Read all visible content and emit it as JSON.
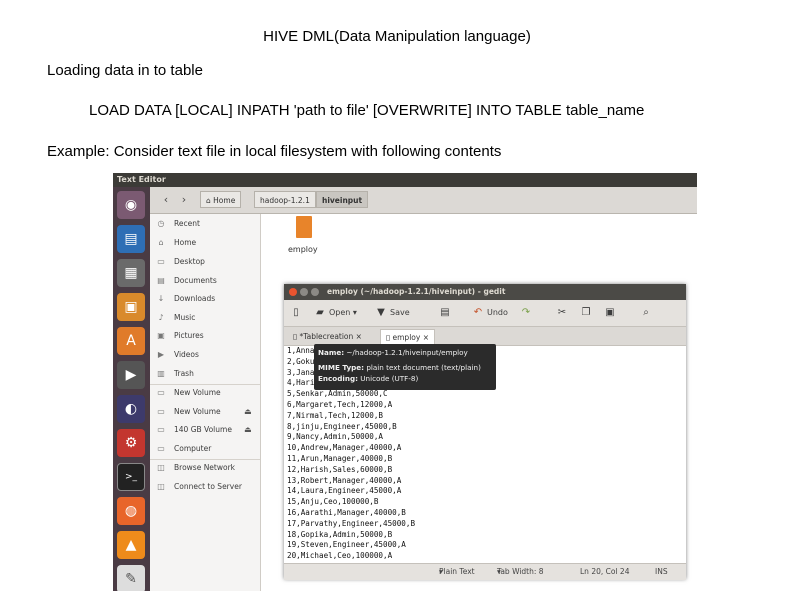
{
  "slide": {
    "title": "HIVE DML(Data Manipulation language)",
    "heading": "Loading  data in to table",
    "syntax": "LOAD DATA [LOCAL] INPATH 'path to file' [OVERWRITE] INTO TABLE table_name",
    "example": "Example: Consider text  file in local filesystem with following contents"
  },
  "screenshot": {
    "app_title": "Text Editor",
    "launcher_icons": [
      "ubuntu-icon",
      "writer-icon",
      "calc-icon",
      "impress-icon",
      "software-center-icon",
      "video-icon",
      "eclipse-icon",
      "settings-icon",
      "terminal-icon",
      "firefox-icon",
      "vlc-icon",
      "editor-icon"
    ],
    "breadcrumbs": [
      "Home",
      "hadoop-1.2.1",
      "hiveinput"
    ],
    "sidebar": {
      "places": [
        {
          "label": "Recent",
          "icon": "clock-icon"
        },
        {
          "label": "Home",
          "icon": "home-icon"
        },
        {
          "label": "Desktop",
          "icon": "desktop-icon"
        },
        {
          "label": "Documents",
          "icon": "documents-icon"
        },
        {
          "label": "Downloads",
          "icon": "downloads-icon"
        },
        {
          "label": "Music",
          "icon": "music-icon"
        },
        {
          "label": "Pictures",
          "icon": "pictures-icon"
        },
        {
          "label": "Videos",
          "icon": "videos-icon"
        },
        {
          "label": "Trash",
          "icon": "trash-icon"
        }
      ],
      "devices": [
        {
          "label": "New Volume",
          "icon": "drive-icon",
          "eject": false
        },
        {
          "label": "New Volume",
          "icon": "drive-icon",
          "eject": true
        },
        {
          "label": "140 GB Volume",
          "icon": "drive-icon",
          "eject": true
        },
        {
          "label": "Computer",
          "icon": "computer-icon",
          "eject": false
        }
      ],
      "network": [
        {
          "label": "Browse Network",
          "icon": "network-icon"
        },
        {
          "label": "Connect to Server",
          "icon": "server-icon"
        }
      ]
    },
    "file": {
      "name": "employ"
    },
    "gedit": {
      "title": "employ (~/hadoop-1.2.1/hiveinput) - gedit",
      "toolbar": {
        "open": "Open",
        "save": "Save",
        "undo": "Undo"
      },
      "tabs": [
        "*Tablecreation",
        "employ"
      ],
      "lines": [
        "1,Anna,",
        "2,Gokul",
        "3,Janak",
        "4,Hari",
        "5,Senkar,Admin,50000,C",
        "6,Margaret,Tech,12000,A",
        "7,Nirmal,Tech,12000,B",
        "8,jinju,Engineer,45000,B",
        "9,Nancy,Admin,50000,A",
        "10,Andrew,Manager,40000,A",
        "11,Arun,Manager,40000,B",
        "12,Harish,Sales,60000,B",
        "13,Robert,Manager,40000,A",
        "14,Laura,Engineer,45000,A",
        "15,Anju,Ceo,100000,B",
        "16,Aarathi,Manager,40000,B",
        "17,Parvathy,Engineer,45000,B",
        "18,Gopika,Admin,50000,B",
        "19,Steven,Engineer,45000,A",
        "20,Michael,Ceo,100000,A"
      ],
      "tooltip": {
        "name_label": "Name:",
        "name_value": "~/hadoop-1.2.1/hiveinput/employ",
        "mime_label": "MIME Type:",
        "mime_value": "plain text document (text/plain)",
        "enc_label": "Encoding:",
        "enc_value": "Unicode (UTF-8)"
      },
      "status": {
        "lang": "Plain Text",
        "tab": "Tab Width: 8",
        "pos": "Ln 20, Col 24",
        "mode": "INS"
      }
    }
  },
  "colors": {
    "launcher": "#4a3b44",
    "topbar": "#3c3b37",
    "accent": "#dd4814"
  }
}
